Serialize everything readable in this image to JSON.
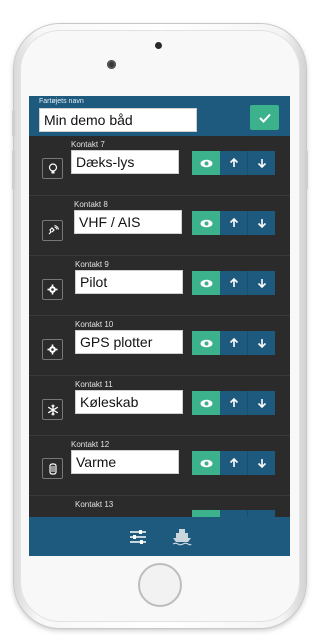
{
  "header": {
    "name_label": "Fartøjets navn",
    "name_value": "Min demo båd",
    "confirm_icon": "check-icon"
  },
  "contacts": [
    {
      "label": "Kontakt 7",
      "value": "Dæks-lys",
      "icon": "bulb-icon"
    },
    {
      "label": "Kontakt 8",
      "value": "VHF / AIS",
      "icon": "radio-icon"
    },
    {
      "label": "Kontakt 9",
      "value": "Pilot",
      "icon": "gear-icon"
    },
    {
      "label": "Kontakt 10",
      "value": "GPS plotter",
      "icon": "gear-icon"
    },
    {
      "label": "Kontakt 11",
      "value": "Køleskab",
      "icon": "snowflake-icon"
    },
    {
      "label": "Kontakt 12",
      "value": "Varme",
      "icon": "heater-icon"
    },
    {
      "label": "Kontakt 13",
      "value": "",
      "icon": ""
    }
  ],
  "bottom_nav": {
    "items": [
      "sliders-icon",
      "ship-icon"
    ]
  },
  "colors": {
    "accent_green": "#3bb28b",
    "primary_blue": "#1d5a7e",
    "background": "#2b2b2b"
  }
}
